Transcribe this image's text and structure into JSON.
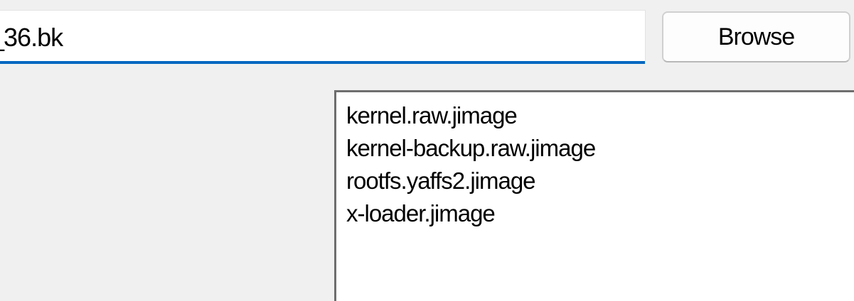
{
  "path_field": {
    "value": "_36.bk"
  },
  "browse_button": {
    "label": "Browse"
  },
  "file_list": {
    "items": [
      "kernel.raw.jimage",
      "kernel-backup.raw.jimage",
      "rootfs.yaffs2.jimage",
      "x-loader.jimage"
    ]
  },
  "colors": {
    "accent": "#0067c0",
    "background": "#f0f0f0"
  }
}
